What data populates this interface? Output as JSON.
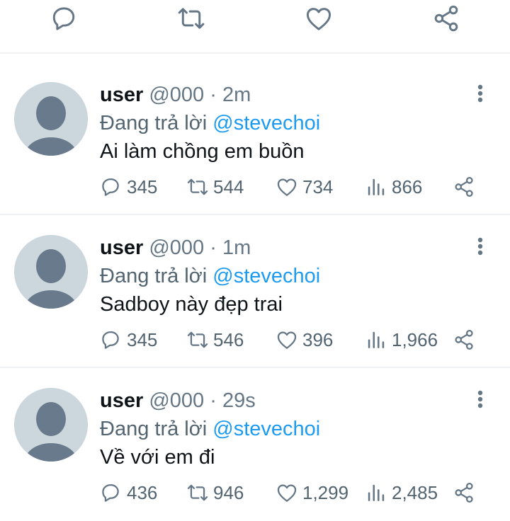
{
  "colors": {
    "icon": "#657786",
    "mention": "#1d9bf0",
    "avatar_bg": "#ccd6dd",
    "avatar_fg": "#687a8c",
    "divider": "#eef0f2"
  },
  "topbar": {
    "icons": [
      "reply-icon",
      "retweet-icon",
      "like-icon",
      "share-icon"
    ]
  },
  "tweets": [
    {
      "name": "user",
      "handle": "@000",
      "sep": "·",
      "time": "2m",
      "reply_prefix": "Đang trả lời ",
      "reply_to": "@stevechoi",
      "text": "Ai làm chồng em buồn",
      "replies": "345",
      "retweets": "544",
      "likes": "734",
      "views": "866"
    },
    {
      "name": "user",
      "handle": "@000",
      "sep": "·",
      "time": "1m",
      "reply_prefix": "Đang trả lời ",
      "reply_to": "@stevechoi",
      "text": "Sadboy này đẹp trai",
      "replies": "345",
      "retweets": "546",
      "likes": "396",
      "views": "1,966"
    },
    {
      "name": "user",
      "handle": "@000",
      "sep": "·",
      "time": "29s",
      "reply_prefix": "Đang trả lời ",
      "reply_to": "@stevechoi",
      "text": "Về với em đi",
      "replies": "436",
      "retweets": "946",
      "likes": "1,299",
      "views": "2,485"
    }
  ]
}
